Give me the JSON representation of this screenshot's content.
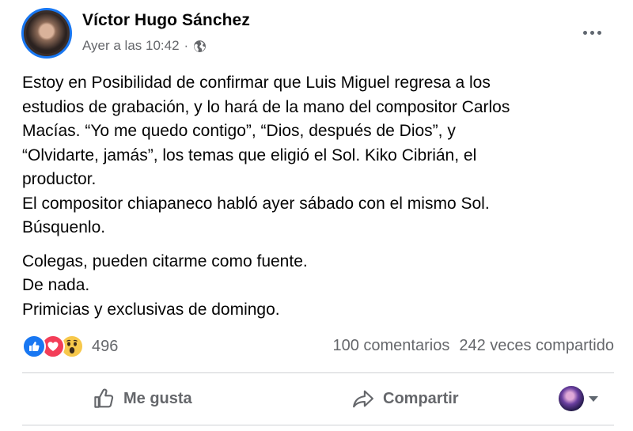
{
  "post": {
    "author": "Víctor Hugo Sánchez",
    "timestamp": "Ayer a las 10:42",
    "separator": "·",
    "privacy_icon": "globe-icon",
    "more_icon": "more-options-icon",
    "body": {
      "paragraph1": [
        "Estoy en Posibilidad de confirmar que Luis Miguel regresa a los",
        "estudios de grabación, y lo hará de la mano del compositor Carlos",
        "Macías. “Yo me quedo contigo”, “Dios, después de Dios”, y",
        "“Olvidarte, jamás”, los temas que eligió el Sol. Kiko Cibrián, el",
        "productor.",
        "El compositor chiapaneco habló ayer sábado con el mismo Sol.",
        "Búsquenlo."
      ],
      "paragraph2": [
        "Colegas, pueden citarme como fuente.",
        "De nada.",
        "Primicias y exclusivas de domingo."
      ]
    },
    "reactions": {
      "types": [
        "like-reaction-icon",
        "love-reaction-icon",
        "wow-reaction-icon"
      ],
      "count": "496"
    },
    "comments": "100 comentarios",
    "shares": "242 veces compartido",
    "actions": {
      "like_label": "Me gusta",
      "share_label": "Compartir"
    },
    "colors": {
      "accent": "#1877f2",
      "love": "#f33e58",
      "wow": "#f7c84b",
      "secondary_text": "#65676b",
      "divider": "#ced0d4"
    }
  }
}
